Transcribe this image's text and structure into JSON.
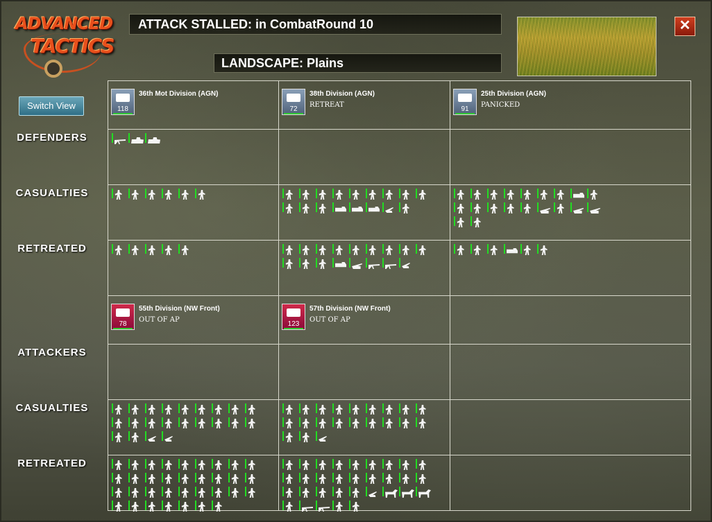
{
  "logo": {
    "line1": "ADVANCED",
    "line2": "TACTICS"
  },
  "header": {
    "title": "ATTACK STALLED: in CombatRound  10",
    "landscape": "LANDSCAPE: Plains",
    "terrain_image": "plains-terrain-photo"
  },
  "buttons": {
    "switch_view": "Switch View",
    "close": "✕"
  },
  "labels": {
    "defenders": "DEFENDERS",
    "casualties": "CASUALTIES",
    "retreated": "RETREATED",
    "attackers": "ATTACKERS"
  },
  "defenders": [
    {
      "name": "36th Mot Division (AGN)",
      "status": "",
      "strength": "118",
      "icon": "truck-icon",
      "side": "ger",
      "defenders_row": [
        "lmg",
        "tank",
        "tank"
      ],
      "casualties": [
        "inf",
        "inf",
        "inf",
        "inf",
        "inf",
        "inf"
      ],
      "retreated": [
        "inf",
        "inf",
        "inf",
        "inf",
        "inf"
      ]
    },
    {
      "name": "38th Division (AGN)",
      "status": "RETREAT",
      "strength": "72",
      "icon": "infantry-icon",
      "side": "ger",
      "defenders_row": [],
      "casualties": [
        "inf",
        "inf",
        "inf",
        "inf",
        "inf",
        "inf",
        "inf",
        "inf",
        "inf",
        "inf",
        "inf",
        "inf",
        "truck",
        "truck",
        "truck",
        "gun",
        "inf"
      ],
      "retreated": [
        "inf",
        "inf",
        "inf",
        "inf",
        "inf",
        "inf",
        "inf",
        "inf",
        "inf",
        "inf",
        "inf",
        "inf",
        "truck",
        "pak",
        "lmg",
        "lmg",
        "gun"
      ]
    },
    {
      "name": "25th Division (AGN)",
      "status": "PANICKED",
      "strength": "91",
      "icon": "pak-icon",
      "side": "ger",
      "defenders_row": [],
      "casualties": [
        "inf",
        "inf",
        "inf",
        "inf",
        "inf",
        "inf",
        "inf",
        "truck",
        "inf",
        "inf",
        "inf",
        "inf",
        "inf",
        "inf",
        "pak",
        "inf",
        "pak",
        "pak",
        "inf",
        "inf"
      ],
      "retreated": [
        "inf",
        "inf",
        "inf",
        "truck",
        "inf",
        "inf"
      ]
    }
  ],
  "attackers": [
    {
      "name": "55th Division (NW Front)",
      "status": "OUT OF AP",
      "strength": "78",
      "icon": "infantry-icon",
      "side": "sov",
      "casualties": [
        "inf",
        "inf",
        "inf",
        "inf",
        "inf",
        "inf",
        "inf",
        "inf",
        "inf",
        "inf",
        "inf",
        "inf",
        "inf",
        "inf",
        "inf",
        "inf",
        "inf",
        "inf",
        "inf",
        "inf",
        "gun",
        "gun"
      ],
      "retreated": [
        "inf",
        "inf",
        "inf",
        "inf",
        "inf",
        "inf",
        "inf",
        "inf",
        "inf",
        "inf",
        "inf",
        "inf",
        "inf",
        "inf",
        "inf",
        "inf",
        "inf",
        "inf",
        "inf",
        "inf",
        "inf",
        "inf",
        "inf",
        "inf",
        "inf",
        "inf",
        "inf",
        "inf",
        "inf",
        "inf",
        "inf",
        "inf",
        "inf",
        "inf"
      ]
    },
    {
      "name": "57th Division (NW Front)",
      "status": "OUT OF AP",
      "strength": "123",
      "icon": "infantry-icon",
      "side": "sov",
      "casualties": [
        "inf",
        "inf",
        "inf",
        "inf",
        "inf",
        "inf",
        "inf",
        "inf",
        "inf",
        "inf",
        "inf",
        "inf",
        "inf",
        "inf",
        "inf",
        "inf",
        "inf",
        "inf",
        "inf",
        "inf",
        "gun"
      ],
      "retreated": [
        "inf",
        "inf",
        "inf",
        "inf",
        "inf",
        "inf",
        "inf",
        "inf",
        "inf",
        "inf",
        "inf",
        "inf",
        "inf",
        "inf",
        "inf",
        "inf",
        "inf",
        "inf",
        "inf",
        "inf",
        "inf",
        "inf",
        "inf",
        "gun",
        "horse",
        "horse",
        "horse",
        "inf",
        "lmg",
        "lmg",
        "inf",
        "inf"
      ]
    }
  ]
}
